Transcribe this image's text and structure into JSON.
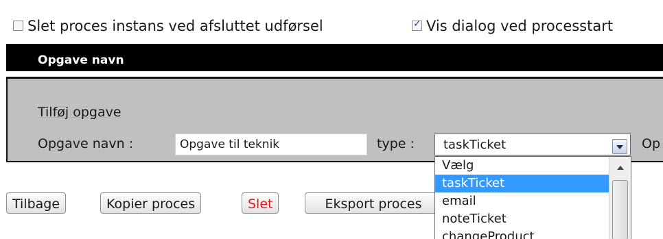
{
  "options_bar": {
    "delete_instance": {
      "label": "Slet proces instans ved afsluttet udførsel",
      "checked": false
    },
    "show_dialog": {
      "label": "Vis dialog ved processtart",
      "checked": true
    }
  },
  "table": {
    "header": "Opgave navn"
  },
  "add_task": {
    "title": "Tilføj opgave",
    "name_label": "Opgave navn :",
    "name_value": "Opgave til teknik",
    "type_label": "type :",
    "type_value": "taskTicket",
    "next_label_clipped": "Op",
    "type_options": [
      "Vælg",
      "taskTicket",
      "email",
      "noteTicket",
      "changeProduct"
    ],
    "selected_option": "taskTicket"
  },
  "buttons": {
    "back": "Tilbage",
    "copy": "Kopier proces",
    "delete": "Slet",
    "export": "Eksport proces"
  },
  "colors": {
    "header_bg": "#000000",
    "panel_bg": "#bfbfbf",
    "selection": "#3399ff",
    "delete_text": "#e0161e"
  }
}
